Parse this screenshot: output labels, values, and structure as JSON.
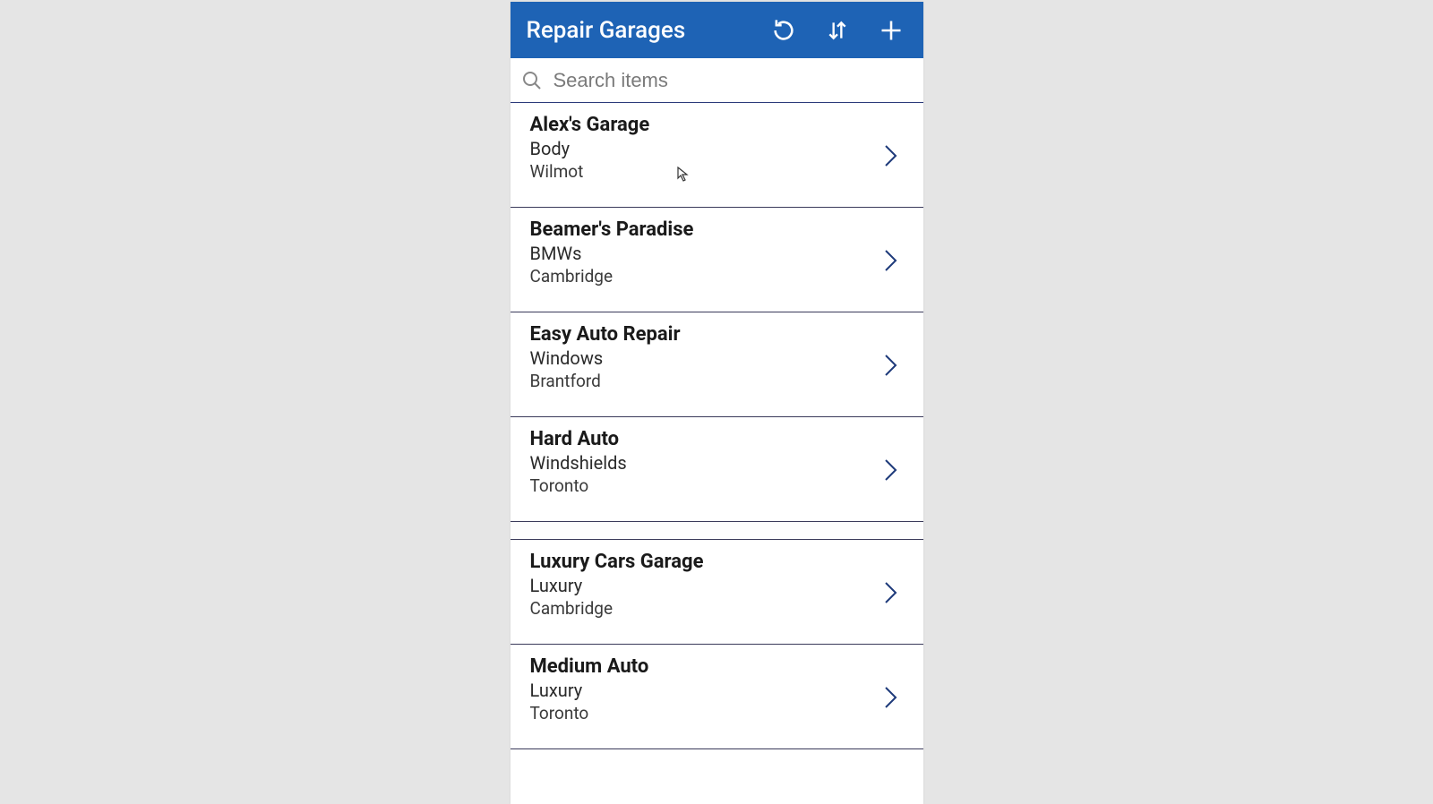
{
  "header": {
    "title": "Repair Garages"
  },
  "search": {
    "placeholder": "Search items"
  },
  "items": [
    {
      "title": "Alex's Garage",
      "subtitle": "Body",
      "location": "Wilmot"
    },
    {
      "title": "Beamer's Paradise",
      "subtitle": "BMWs",
      "location": "Cambridge"
    },
    {
      "title": "Easy Auto Repair",
      "subtitle": "Windows",
      "location": "Brantford"
    },
    {
      "title": "Hard Auto",
      "subtitle": "Windshields",
      "location": "Toronto"
    },
    {
      "title": "Luxury Cars Garage",
      "subtitle": "Luxury",
      "location": "Cambridge"
    },
    {
      "title": "Medium Auto",
      "subtitle": "Luxury",
      "location": "Toronto"
    }
  ],
  "colors": {
    "header_bg": "#1e63b5",
    "page_bg": "#e5e5e5",
    "chevron": "#1e3a7a"
  }
}
